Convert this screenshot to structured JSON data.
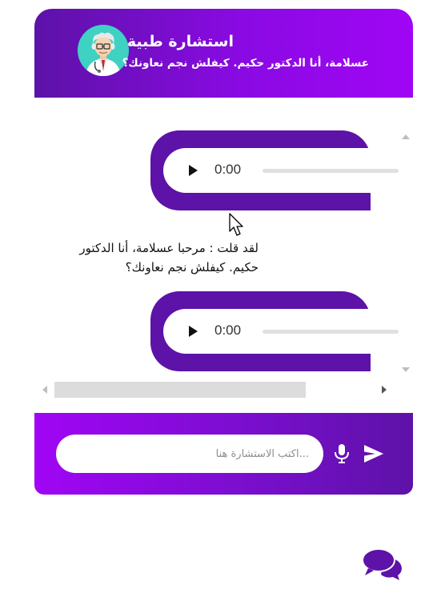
{
  "header": {
    "title": "استشارة طبية",
    "subtitle": "عسلامة، أنا الدكتور حكيم. كيفلش نجم نعاونك؟",
    "avatar_icon": "doctor-avatar-icon"
  },
  "messages": [
    {
      "type": "audio",
      "time": "0:00",
      "progress": 0
    },
    {
      "type": "text",
      "text": "لقد قلت : مرحبا عسلامة، أنا الدكتور حكيم. كيفلش نجم نعاونك؟"
    },
    {
      "type": "audio",
      "time": "0:00",
      "progress": 0
    }
  ],
  "input": {
    "placeholder": "...اكتب الاستشارة هنا",
    "value": ""
  },
  "icons": {
    "mic": "microphone-icon",
    "send": "send-icon",
    "launcher": "chat-bubbles-icon",
    "play": "play-icon"
  },
  "colors": {
    "primary_dark": "#5d12a8",
    "primary_bright": "#a005f5",
    "avatar_bg": "#3fd1c2"
  }
}
